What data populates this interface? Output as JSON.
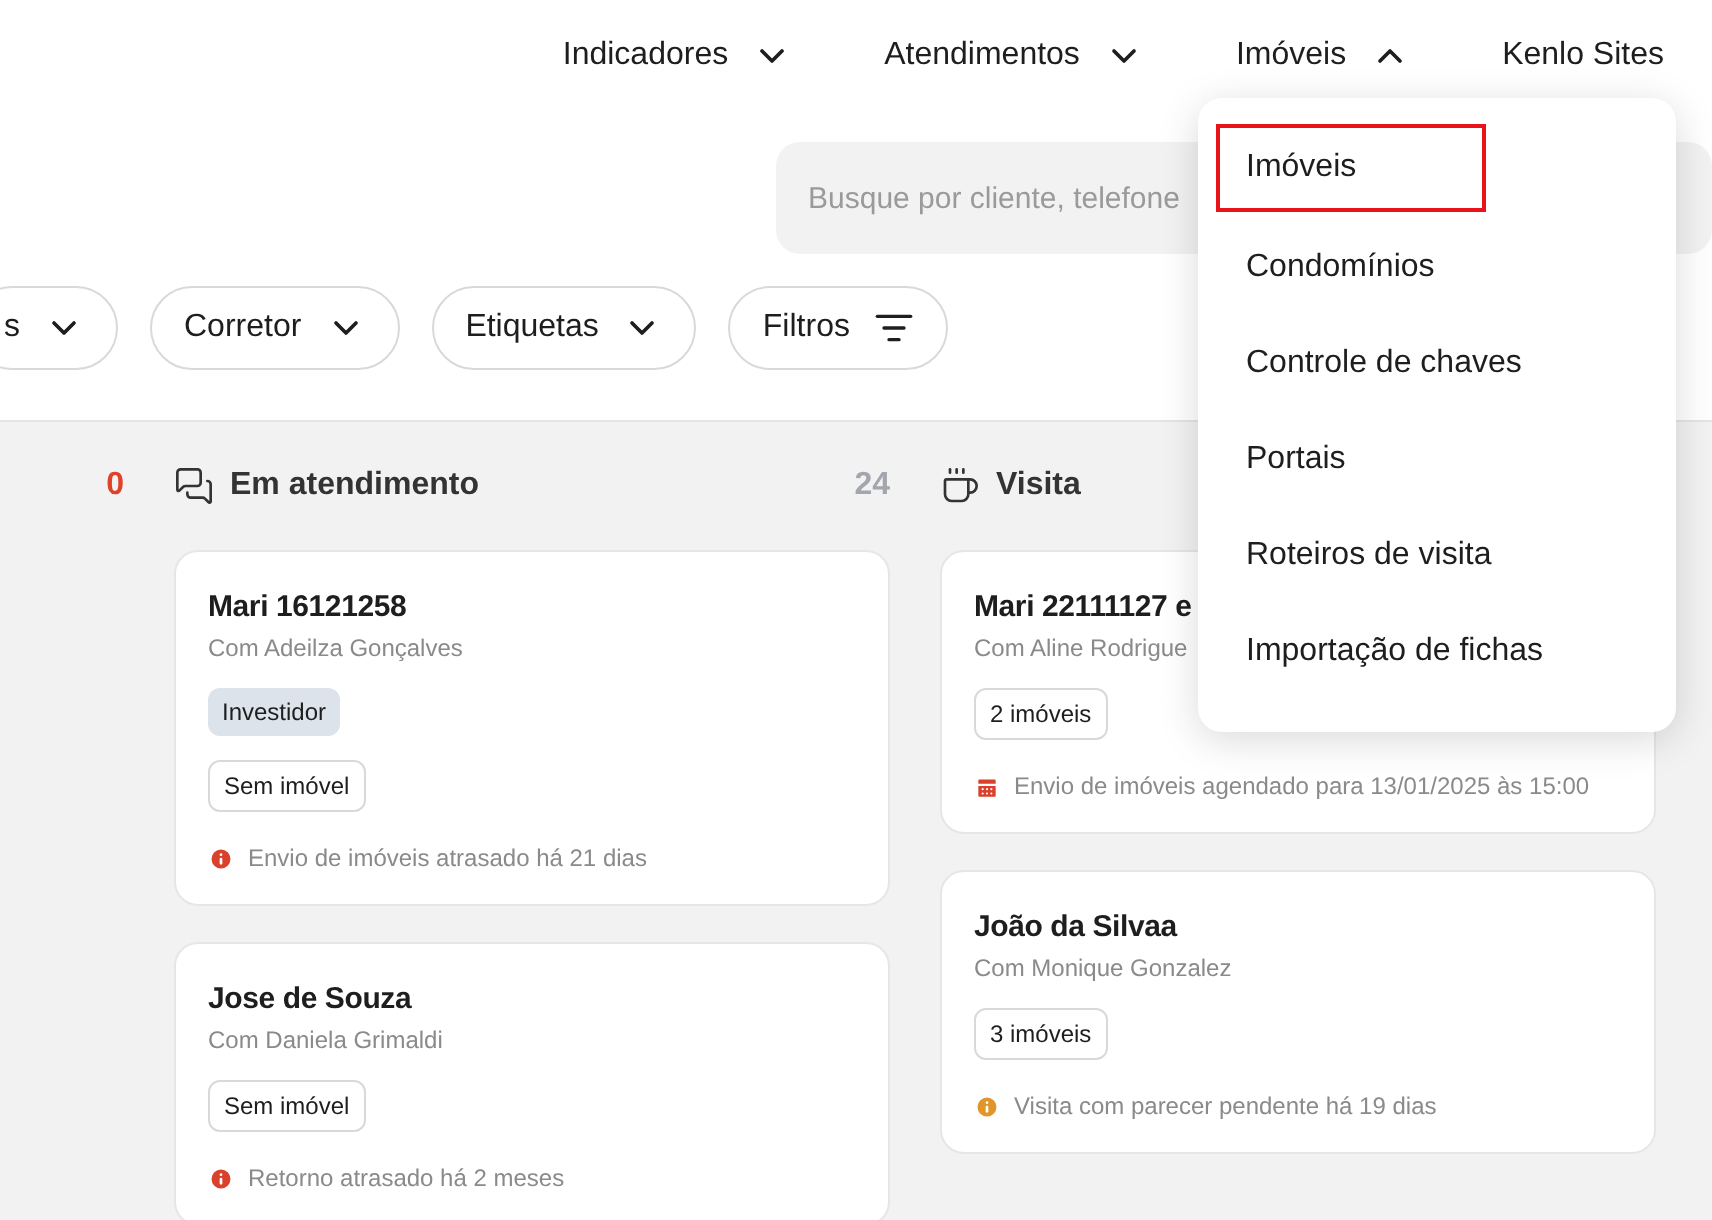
{
  "nav": [
    {
      "label": "Indicadores",
      "kind": "dropdown",
      "expanded": false
    },
    {
      "label": "Atendimentos",
      "kind": "dropdown",
      "expanded": false
    },
    {
      "label": "Imóveis",
      "kind": "dropdown",
      "expanded": true
    },
    {
      "label": "Kenlo Sites",
      "kind": "link"
    }
  ],
  "search": {
    "placeholder": "Busque por cliente, telefone"
  },
  "filters": [
    {
      "label": "s",
      "kind": "dropdown"
    },
    {
      "label": "Corretor",
      "kind": "dropdown"
    },
    {
      "label": "Etiquetas",
      "kind": "dropdown"
    },
    {
      "label": "Filtros",
      "kind": "filter"
    }
  ],
  "columns": [
    {
      "count": "0",
      "color": "#e0412b"
    },
    {
      "title": "Em atendimento",
      "count": "24",
      "color": "#a3a7ad",
      "cards": [
        {
          "title": "Mari 16121258",
          "subtitle": "Com Adeilza Gonçalves",
          "tags": [
            {
              "label": "Investidor",
              "kind": "tag"
            },
            {
              "label": "Sem imóvel",
              "kind": "chip"
            }
          ],
          "alert": {
            "text": "Envio de imóveis atrasado há 21 dias",
            "kind": "overdue"
          }
        },
        {
          "title": "Jose de Souza",
          "subtitle": "Com Daniela Grimaldi",
          "tags": [
            {
              "label": "Sem imóvel",
              "kind": "chip"
            }
          ],
          "alert": {
            "text": "Retorno atrasado há 2 meses",
            "kind": "overdue"
          }
        }
      ]
    },
    {
      "title": "Visita",
      "cards": [
        {
          "title": "Mari 22111127 e",
          "subtitle": "Com Aline Rodrigue",
          "tags": [
            {
              "label": "2 imóveis",
              "kind": "chip"
            }
          ],
          "alert": {
            "text": "Envio de imóveis agendado para 13/01/2025 às 15:00",
            "kind": "scheduled"
          }
        },
        {
          "title": "João da Silvaa",
          "subtitle": "Com Monique Gonzalez",
          "tags": [
            {
              "label": "3 imóveis",
              "kind": "chip"
            }
          ],
          "alert": {
            "text": "Visita com parecer pendente há 19 dias",
            "kind": "pending"
          }
        }
      ]
    }
  ],
  "menu": {
    "items": [
      {
        "label": "Imóveis",
        "selected": true
      },
      {
        "label": "Condomínios",
        "selected": false
      },
      {
        "label": "Controle de chaves",
        "selected": false
      },
      {
        "label": "Portais",
        "selected": false
      },
      {
        "label": "Roteiros de visita",
        "selected": false
      },
      {
        "label": "Importação de fichas",
        "selected": false
      }
    ]
  }
}
